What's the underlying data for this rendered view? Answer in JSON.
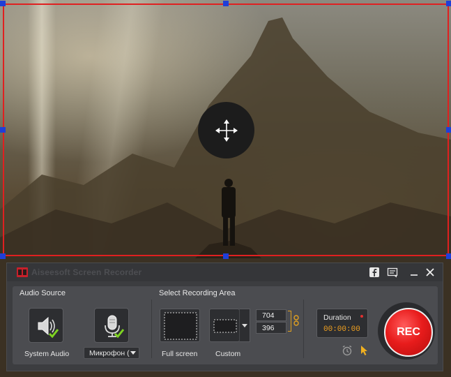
{
  "app": {
    "title": "Aiseesoft Screen Recorder"
  },
  "titlebar_icons": [
    "facebook-icon",
    "feedback-icon",
    "minimize-icon",
    "close-icon"
  ],
  "audio_source": {
    "label": "Audio Source",
    "system_audio_label": "System Audio",
    "microphone_value": "Микрофон ("
  },
  "recording_area": {
    "label": "Select Recording Area",
    "full_screen_label": "Full screen",
    "custom_label": "Custom",
    "width": "704",
    "height": "396"
  },
  "duration": {
    "label": "Duration",
    "time": "00:00:00"
  },
  "rec_button": {
    "label": "REC"
  },
  "colors": {
    "selection_border": "#e02020",
    "handle": "#1f3fd8",
    "rec_red": "#e81c1c",
    "duration_text": "#f0a020",
    "check_green": "#7ed321"
  }
}
